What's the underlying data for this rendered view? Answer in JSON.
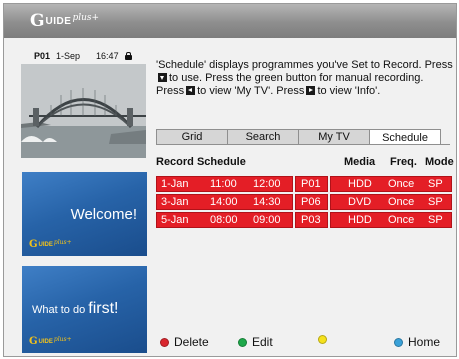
{
  "header": {
    "logo_main": "G",
    "logo_rest": "UIDE",
    "logo_plus": "plus+"
  },
  "infobar": {
    "channel": "P01",
    "date": "1-Sep",
    "time": "16:47"
  },
  "preview": {
    "image": "sydney-harbour-bridge-opera-house"
  },
  "promos": [
    {
      "text": "Welcome!",
      "logo_main": "G",
      "logo_rest": "UIDE",
      "logo_plus": "plus+"
    },
    {
      "text_small": "What to do",
      "text_big": "first!",
      "logo_main": "G",
      "logo_rest": "UIDE",
      "logo_plus": "plus+"
    }
  ],
  "description": {
    "part1": "'Schedule' displays programmes you've Set to Record. Press",
    "part2": "to use.  Press the green button for manual recording. Press",
    "part3": "to view 'My TV'.  Press",
    "part4": "to view 'Info'."
  },
  "tabs": [
    {
      "label": "Grid",
      "active": false
    },
    {
      "label": "Search",
      "active": false
    },
    {
      "label": "My TV",
      "active": false
    },
    {
      "label": "Schedule",
      "active": true
    }
  ],
  "schedule": {
    "title": "Record Schedule",
    "columns": {
      "media": "Media",
      "freq": "Freq.",
      "mode": "Mode"
    },
    "rows": [
      {
        "date": "1-Jan",
        "start": "11:00",
        "end": "12:00",
        "channel": "P01",
        "media": "HDD",
        "freq": "Once",
        "mode": "SP"
      },
      {
        "date": "3-Jan",
        "start": "14:00",
        "end": "14:30",
        "channel": "P06",
        "media": "DVD",
        "freq": "Once",
        "mode": "SP"
      },
      {
        "date": "5-Jan",
        "start": "08:00",
        "end": "09:00",
        "channel": "P03",
        "media": "HDD",
        "freq": "Once",
        "mode": "SP"
      }
    ],
    "row_color": "#e41e26"
  },
  "footer": {
    "keys": [
      {
        "label": "Delete",
        "color": "#d9262e"
      },
      {
        "label": "Edit",
        "color": "#1ea84a"
      },
      {
        "label": "",
        "color": "#f5e11c"
      },
      {
        "label": "Home",
        "color": "#3aa1d8"
      }
    ]
  }
}
